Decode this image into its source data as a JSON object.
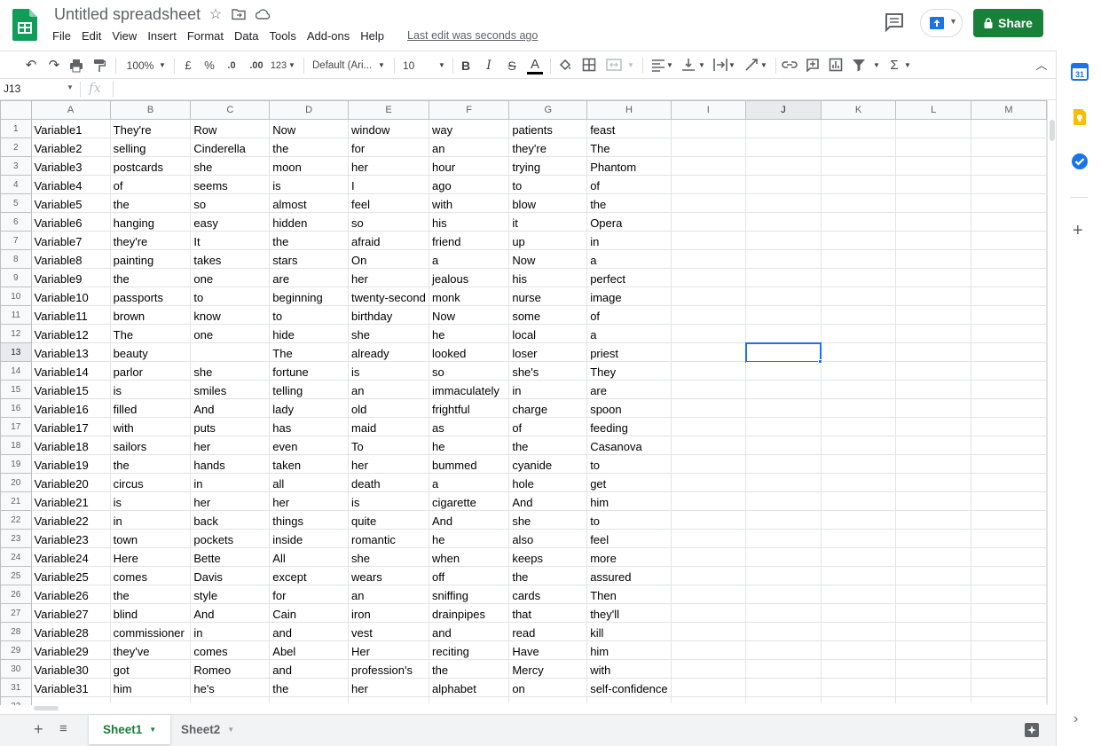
{
  "app": {
    "title": "Untitled spreadsheet",
    "last_edit": "Last edit was seconds ago",
    "share_label": "Share",
    "accent_color": "#188038"
  },
  "menu": [
    "File",
    "Edit",
    "View",
    "Insert",
    "Format",
    "Data",
    "Tools",
    "Add-ons",
    "Help"
  ],
  "toolbar": {
    "zoom": "100%",
    "currency": "£",
    "percent": "%",
    "dec_less": ".0",
    "dec_more": ".00",
    "more_formats": "123",
    "font": "Default (Ari...",
    "font_size": "10",
    "bold": "B",
    "italic": "I",
    "strike": "S",
    "text_color": "A",
    "functions": "Σ"
  },
  "formula_bar": {
    "name_box": "J13",
    "fx": "fx",
    "value": ""
  },
  "grid": {
    "columns": [
      "A",
      "B",
      "C",
      "D",
      "E",
      "F",
      "G",
      "H",
      "I",
      "J",
      "K",
      "L",
      "M"
    ],
    "selected_cell": "J13",
    "rows": [
      [
        "Variable1",
        "They're",
        "Row",
        "Now",
        "window",
        "way",
        "patients",
        "feast"
      ],
      [
        "Variable2",
        "selling",
        "Cinderella",
        "the",
        "for",
        "an",
        "they're",
        "The"
      ],
      [
        "Variable3",
        "postcards",
        "she",
        "moon",
        "her",
        "hour",
        "trying",
        "Phantom"
      ],
      [
        "Variable4",
        "of",
        "seems",
        "is",
        "I",
        "ago",
        "to",
        "of"
      ],
      [
        "Variable5",
        "the",
        "so",
        "almost",
        "feel",
        "with",
        "blow",
        "the"
      ],
      [
        "Variable6",
        "hanging",
        "easy",
        "hidden",
        "so",
        "his",
        "it",
        "Opera"
      ],
      [
        "Variable7",
        "they're",
        "It",
        "the",
        "afraid",
        "friend",
        "up",
        "in"
      ],
      [
        "Variable8",
        "painting",
        "takes",
        "stars",
        "On",
        "a",
        "Now",
        "a"
      ],
      [
        "Variable9",
        "the",
        "one",
        "are",
        "her",
        "jealous",
        "his",
        "perfect"
      ],
      [
        "Variable10",
        "passports",
        "to",
        "beginning",
        "twenty-second",
        "monk",
        "nurse",
        "image"
      ],
      [
        "Variable11",
        "brown",
        "know",
        "to",
        "birthday",
        "Now",
        "some",
        "of"
      ],
      [
        "Variable12",
        "The",
        "one",
        "hide",
        "she",
        "he",
        "local",
        "a"
      ],
      [
        "Variable13",
        "beauty",
        "",
        "The",
        "already",
        "looked",
        "loser",
        "priest"
      ],
      [
        "Variable14",
        "parlor",
        "she",
        "fortune",
        "is",
        "so",
        "she's",
        "They"
      ],
      [
        "Variable15",
        "is",
        "smiles",
        "telling",
        "an",
        "immaculately",
        "in",
        "are"
      ],
      [
        "Variable16",
        "filled",
        "And",
        "lady",
        "old",
        "frightful",
        "charge",
        "spoon"
      ],
      [
        "Variable17",
        "with",
        "puts",
        "has",
        "maid",
        "as",
        "of",
        "feeding"
      ],
      [
        "Variable18",
        "sailors",
        "her",
        "even",
        "To",
        "he",
        "the",
        "Casanova"
      ],
      [
        "Variable19",
        "the",
        "hands",
        "taken",
        "her",
        "bummed",
        "cyanide",
        "to"
      ],
      [
        "Variable20",
        "circus",
        "in",
        "all",
        "death",
        "a",
        "hole",
        "get"
      ],
      [
        "Variable21",
        "is",
        "her",
        "her",
        "is",
        "cigarette",
        "And",
        "him"
      ],
      [
        "Variable22",
        "in",
        "back",
        "things",
        "quite",
        "And",
        "she",
        "to"
      ],
      [
        "Variable23",
        "town",
        "pockets",
        "inside",
        "romantic",
        "he",
        "also",
        "feel"
      ],
      [
        "Variable24",
        "Here",
        "Bette",
        "All",
        "she",
        "when",
        "keeps",
        "more"
      ],
      [
        "Variable25",
        "comes",
        "Davis",
        "except",
        "wears",
        "off",
        "the",
        "assured"
      ],
      [
        "Variable26",
        "the",
        "style",
        "for",
        "an",
        "sniffing",
        "cards",
        "Then"
      ],
      [
        "Variable27",
        "blind",
        "And",
        "Cain",
        "iron",
        "drainpipes",
        "that",
        "they'll"
      ],
      [
        "Variable28",
        "commissioner",
        "in",
        "and",
        "vest",
        "and",
        "read",
        "kill"
      ],
      [
        "Variable29",
        "they've",
        "comes",
        "Abel",
        "Her",
        "reciting",
        "Have",
        "him"
      ],
      [
        "Variable30",
        "got",
        "Romeo",
        "and",
        "profession's",
        "the",
        "Mercy",
        "with"
      ],
      [
        "Variable31",
        "him",
        "he's",
        "the",
        "her",
        "alphabet",
        "on",
        "self-confidence"
      ]
    ]
  },
  "sheets": [
    "Sheet1",
    "Sheet2"
  ],
  "active_sheet": "Sheet1"
}
